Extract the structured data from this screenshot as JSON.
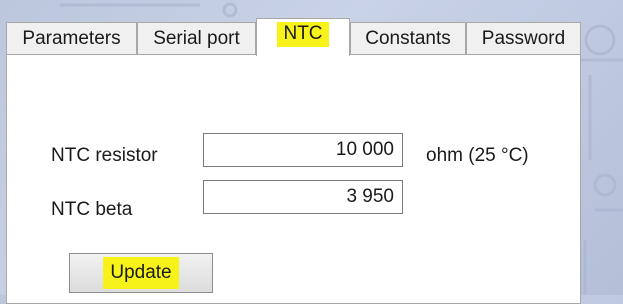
{
  "tabs": [
    {
      "label": "Parameters",
      "active": false
    },
    {
      "label": "Serial port",
      "active": false
    },
    {
      "label": "NTC",
      "active": true
    },
    {
      "label": "Constants",
      "active": false
    },
    {
      "label": "Password",
      "active": false
    }
  ],
  "ntc": {
    "resistor_label": "NTC resistor",
    "resistor_value": "10 000",
    "resistor_unit": "ohm (25 °C)",
    "beta_label": "NTC beta",
    "beta_value": "3 950",
    "update_label": "Update"
  },
  "colors": {
    "highlight": "#f7f21a",
    "panel_bg": "#ffffff",
    "tab_bg": "#f0f0f0",
    "border": "#a8a8a8"
  }
}
